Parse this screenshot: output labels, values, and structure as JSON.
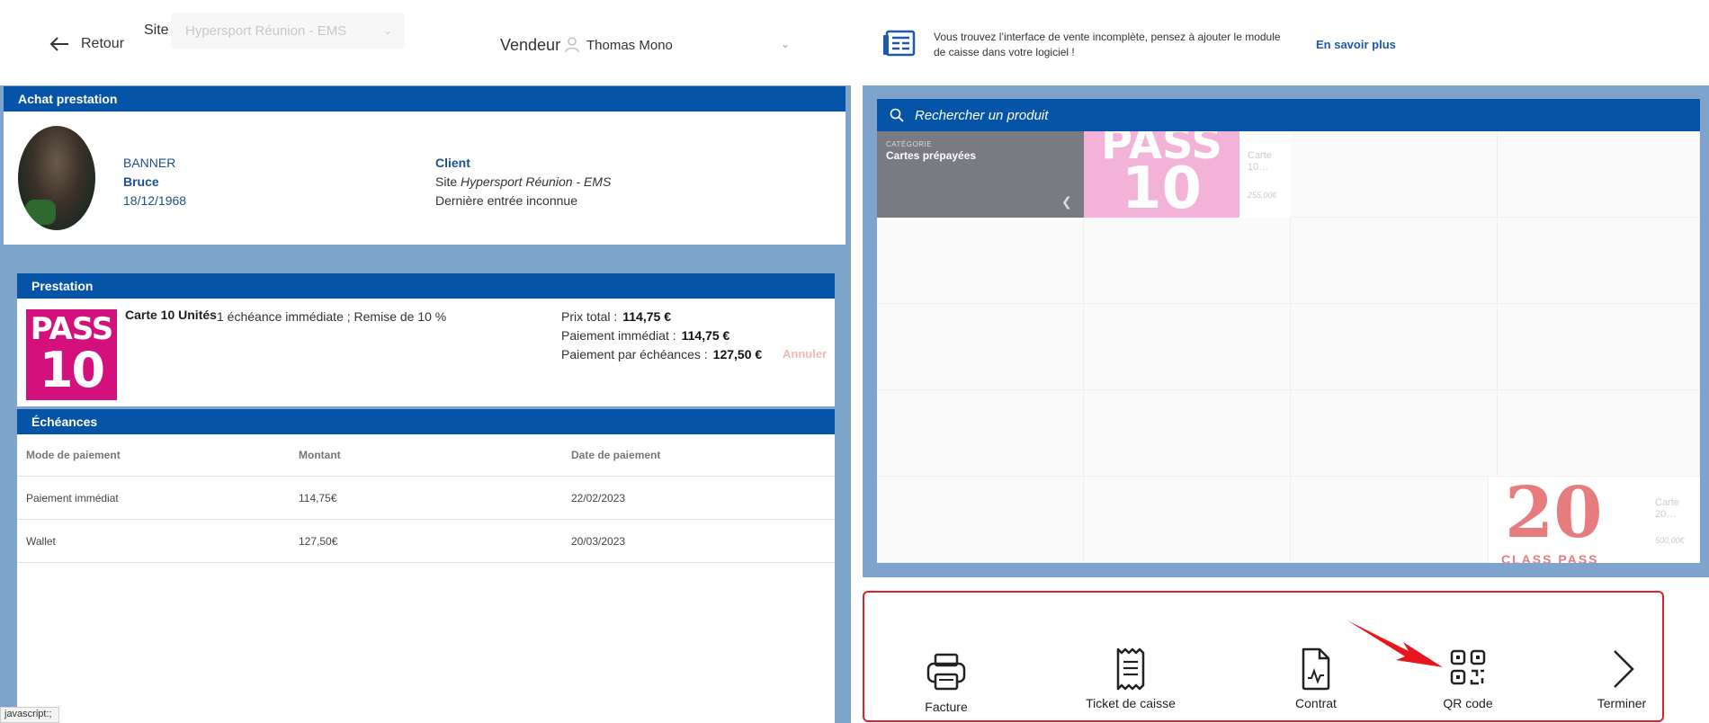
{
  "topbar": {
    "back_label": "Retour",
    "site_label": "Site",
    "site_value": "Hypersport Réunion - EMS",
    "vendeur_label": "Vendeur",
    "vendeur_value": "Thomas Mono",
    "info_text": "Vous trouvez l’interface de vente incomplète, pensez à ajouter le module de caisse dans votre logiciel !",
    "info_link": "En savoir plus"
  },
  "achat": {
    "header": "Achat prestation",
    "last_name": "BANNER",
    "first_name": "Bruce",
    "birth_date": "18/12/1968",
    "client_title": "Client",
    "site_prefix": "Site ",
    "site_name": "Hypersport Réunion - EMS",
    "last_entry": "Dernière entrée inconnue"
  },
  "prestation": {
    "header": "Prestation",
    "image_line1": "PASS",
    "image_line2": "10",
    "name": "Carte 10 Unités",
    "description": "1 échéance immédiate ; Remise de 10 %",
    "total_label": "Prix total :",
    "total_value": "114,75 €",
    "immediate_label": "Paiement immédiat :",
    "immediate_value": "114,75 €",
    "installments_label": "Paiement par échéances :",
    "installments_value": "127,50 €",
    "cancel_label": "Annuler"
  },
  "echeances": {
    "header": "Échéances",
    "columns": [
      "Mode de paiement",
      "Montant",
      "Date de paiement"
    ],
    "rows": [
      [
        "Paiement immédiat",
        "114,75€",
        "22/02/2023"
      ],
      [
        "Wallet",
        "127,50€",
        "20/03/2023"
      ]
    ]
  },
  "catalog": {
    "search_placeholder": "Rechercher un produit",
    "category_small": "CATÉGORIE",
    "category_name": "Cartes prépayées",
    "product1_image_a": "PASS",
    "product1_image_b": "10",
    "product1_name": "Carte 10…",
    "product1_price": "255,00€",
    "product2_image_num": "20",
    "product2_image_label": "CLASS PASS",
    "product2_name": "Carte 20…",
    "product2_price": "500,00€"
  },
  "actions": [
    {
      "label": "Facture",
      "icon": "printer-icon"
    },
    {
      "label": "Ticket de caisse",
      "icon": "receipt-icon"
    },
    {
      "label": "Contrat",
      "icon": "contract-icon"
    },
    {
      "label": "QR code",
      "icon": "qr-code-icon"
    },
    {
      "label": "Terminer",
      "icon": "chevron-right-icon"
    }
  ],
  "status_bar": "javascript:;",
  "colors": {
    "brand_blue": "#0654a8",
    "panel_blue": "#7ea3cc",
    "highlight_red": "#e0202a",
    "pass_pink": "#d4107c"
  }
}
